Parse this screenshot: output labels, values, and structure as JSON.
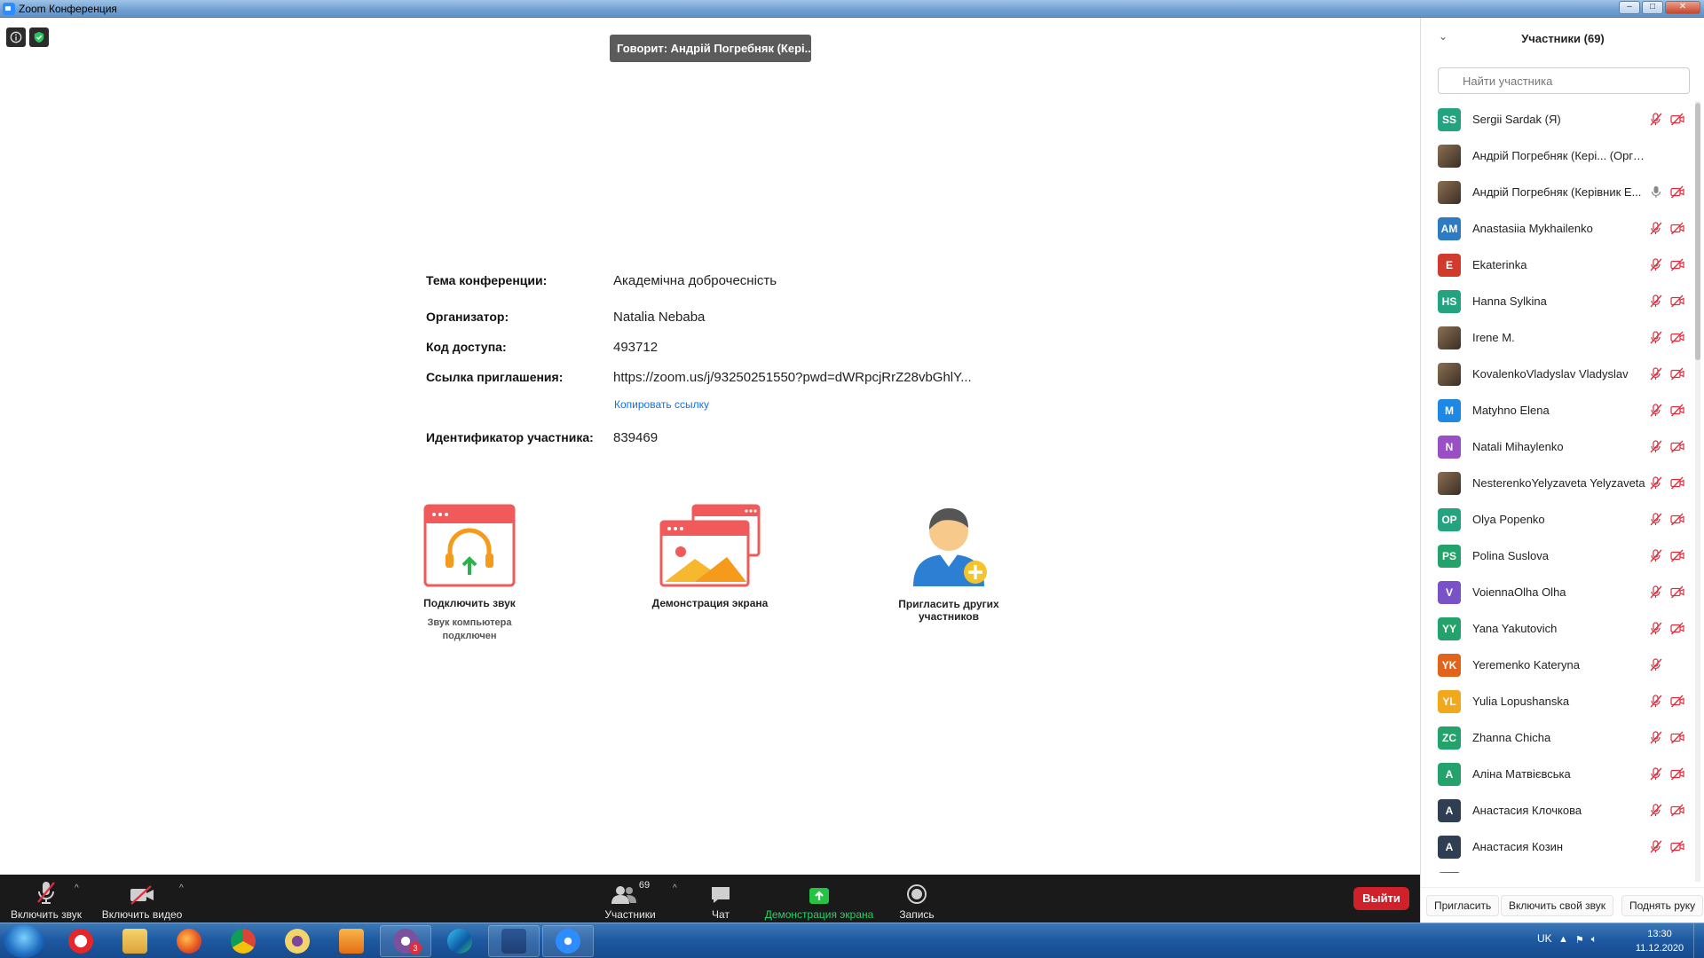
{
  "window": {
    "title": "Zoom Конференция"
  },
  "speaker": "Говорит: Андрій Погребняк (Кері...",
  "meeting_info": {
    "topic_label": "Тема конференции:",
    "topic": "Академічна доброчесність",
    "host_label": "Организатор:",
    "host": "Natalia Nebaba",
    "passcode_label": "Код доступа:",
    "passcode": "493712",
    "invite_label": "Ссылка приглашения:",
    "invite_link": "https://zoom.us/j/93250251550?pwd=dWRpcjRrZ28vbGhlY...",
    "copy_link": "Копировать ссылку",
    "participant_id_label": "Идентификатор участника:",
    "participant_id": "839469"
  },
  "tiles": {
    "join_audio": "Подключить звук",
    "join_audio_sub": "Звук компьютера подключен",
    "share_screen": "Демонстрация экрана",
    "invite": "Пригласить других участников"
  },
  "toolbar": {
    "unmute": "Включить звук",
    "start_video": "Включить видео",
    "participants": "Участники",
    "participants_count": "69",
    "chat": "Чат",
    "share": "Демонстрация экрана",
    "record": "Запись",
    "leave": "Выйти"
  },
  "panel": {
    "title": "Участники (69)",
    "search_placeholder": "Найти участника",
    "invite": "Пригласить",
    "unmute_me": "Включить свой звук",
    "raise_hand": "Поднять руку",
    "participants": [
      {
        "initials": "SS",
        "color": "#23a380",
        "name": "Sergii Sardak (Я)",
        "mic": "muted",
        "video": "off"
      },
      {
        "initials": "",
        "color": "#6b5a48",
        "photo": true,
        "name": "Андрій Погребняк (Кері... (Организатор)",
        "mic": "none",
        "video": "none"
      },
      {
        "initials": "",
        "color": "#6b5a48",
        "photo": true,
        "name": "Андрій Погребняк (Керівник Е...",
        "mic": "on",
        "video": "off"
      },
      {
        "initials": "AM",
        "color": "#2f7bc2",
        "name": "Anastasiia Mykhailenko",
        "mic": "muted",
        "video": "off"
      },
      {
        "initials": "E",
        "color": "#d13b2e",
        "name": "Ekaterinka",
        "mic": "muted",
        "video": "off"
      },
      {
        "initials": "HS",
        "color": "#23a380",
        "name": "Hanna Sylkina",
        "mic": "muted",
        "video": "off"
      },
      {
        "initials": "",
        "color": "#444",
        "photo": true,
        "name": "Irene M.",
        "mic": "muted",
        "video": "off"
      },
      {
        "initials": "",
        "color": "#8aa06a",
        "photo": true,
        "name": "KovalenkoVladyslav Vladyslav",
        "mic": "muted",
        "video": "off"
      },
      {
        "initials": "M",
        "color": "#1e88e5",
        "name": "Matyhno Elena",
        "mic": "muted",
        "video": "off"
      },
      {
        "initials": "N",
        "color": "#9b4fc4",
        "name": "Natali Mihaylenko",
        "mic": "muted",
        "video": "off"
      },
      {
        "initials": "",
        "color": "#3a2a22",
        "photo": true,
        "name": "NesterenkoYelyzaveta Yelyzaveta",
        "mic": "muted",
        "video": "off"
      },
      {
        "initials": "OP",
        "color": "#23a380",
        "name": "Olya Popenko",
        "mic": "muted",
        "video": "off"
      },
      {
        "initials": "PS",
        "color": "#23a36b",
        "name": "Polina Suslova",
        "mic": "muted",
        "video": "off"
      },
      {
        "initials": "V",
        "color": "#7a52c7",
        "name": "VoiennaOlha Olha",
        "mic": "muted",
        "video": "off"
      },
      {
        "initials": "YY",
        "color": "#23a36b",
        "name": "Yana Yakutovich",
        "mic": "muted",
        "video": "off"
      },
      {
        "initials": "YK",
        "color": "#e0641b",
        "name": "Yeremenko Kateryna",
        "mic": "muted",
        "video": "none"
      },
      {
        "initials": "YL",
        "color": "#f2a81d",
        "name": "Yulia Lopushanska",
        "mic": "muted",
        "video": "off"
      },
      {
        "initials": "ZC",
        "color": "#23a36b",
        "name": "Zhanna Chicha",
        "mic": "muted",
        "video": "off"
      },
      {
        "initials": "A",
        "color": "#23a36b",
        "name": "Аліна Матвієвська",
        "mic": "muted",
        "video": "off"
      },
      {
        "initials": "A",
        "color": "#2f3e52",
        "name": "Анастасия Клочкова",
        "mic": "muted",
        "video": "off"
      },
      {
        "initials": "A",
        "color": "#2f3e52",
        "name": "Анастасия Козин",
        "mic": "muted",
        "video": "off"
      },
      {
        "initials": "",
        "color": "#b08c6e",
        "photo": true,
        "name": "",
        "mic": "muted",
        "video": "off"
      }
    ]
  },
  "taskbar": {
    "apps": [
      "opera",
      "explorer",
      "firefox",
      "chrome",
      "tor",
      "media-player",
      "viber",
      "edge",
      "word",
      "zoom"
    ],
    "viber_badge": "3",
    "language": "UK",
    "time": "13:30",
    "date": "11.12.2020"
  }
}
